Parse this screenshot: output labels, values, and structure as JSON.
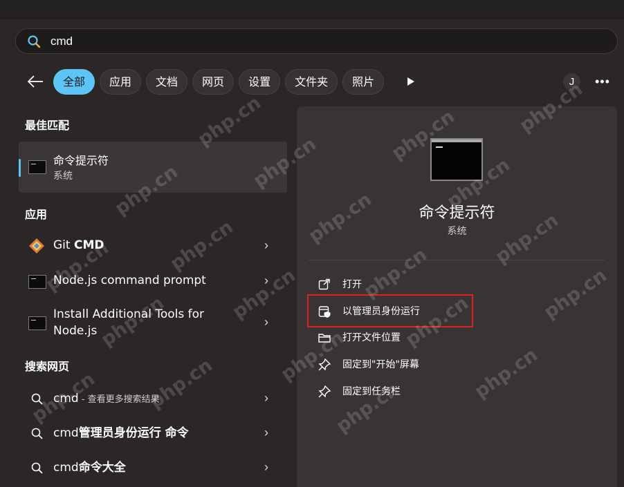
{
  "search": {
    "value": "cmd"
  },
  "filters": [
    "全部",
    "应用",
    "文档",
    "网页",
    "设置",
    "文件夹",
    "照片"
  ],
  "user_initial": "J",
  "more_label": "•••",
  "sections": {
    "best_match": "最佳匹配",
    "apps": "应用",
    "web": "搜索网页"
  },
  "best_match": {
    "title": "命令提示符",
    "subtitle": "系统"
  },
  "apps": [
    {
      "pre": "Git ",
      "bold": "CMD",
      "icon": "git-icon"
    },
    {
      "label": "Node.js command prompt",
      "icon": "terminal-icon"
    },
    {
      "line1": "Install Additional Tools for",
      "line2": "Node.js",
      "icon": "terminal-icon"
    }
  ],
  "web_results": [
    {
      "query": "cmd",
      "hint": " - 查看更多搜索结果"
    },
    {
      "pre": "cmd",
      "bold": "管理员身份运行 命令"
    },
    {
      "pre": "cmd",
      "bold": "命令大全"
    }
  ],
  "detail": {
    "title": "命令提示符",
    "subtitle": "系统",
    "actions": [
      {
        "label": "打开",
        "icon": "open-external-icon"
      },
      {
        "label": "以管理员身份运行",
        "icon": "shield-admin-icon"
      },
      {
        "label": "打开文件位置",
        "icon": "folder-icon"
      },
      {
        "label": "固定到\"开始\"屏幕",
        "icon": "pin-icon"
      },
      {
        "label": "固定到任务栏",
        "icon": "pin-icon"
      }
    ]
  },
  "watermark": "php.cn",
  "colors": {
    "accent": "#5cc5f5",
    "highlight": "#e02020"
  }
}
